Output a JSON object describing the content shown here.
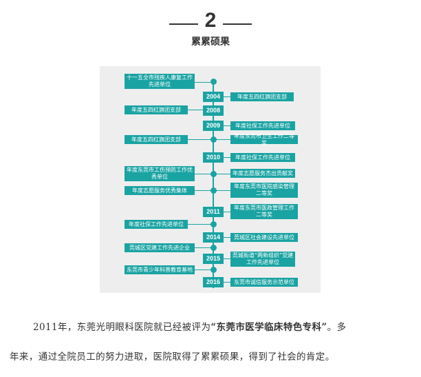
{
  "section": {
    "number": "2",
    "title": "累累硕果"
  },
  "timeline": {
    "years": [
      "2004",
      "2008",
      "2009",
      "2010",
      "2011",
      "2014",
      "2015",
      "2016"
    ],
    "left": [
      "十一五全市残疾人康复工作先进单位",
      "年度五四红旗团支部",
      "年度五四红旗团支部",
      "年度东莞市工伤预防工作优秀单位",
      "年度志愿服务优秀集体",
      "年度社保工作先进单位",
      "莞城区党建工作先进企业",
      "东莞市青少年科普教育基地"
    ],
    "right": [
      "年度五四红旗团支部",
      "年度社保工作先进单位",
      "年度东莞市卫生工作二等奖",
      "年度社保工作先进单位",
      "年度志愿服务杰出贡献奖",
      "年度东莞市医院感染管理二等奖",
      "年度东莞市医政管理工作二等奖",
      "莞城区社会建设先进单位",
      "莞城街道“两新组织”党建工作先进单位",
      "东莞市诚信服务示范单位"
    ]
  },
  "paragraph": {
    "p1_before": "2011年，东莞光明眼科医院就已经被评为",
    "p1_highlight": "“东莞市医学临床特色专科”",
    "p1_after": "。多",
    "p2": "年来，通过全院员工的努力进取，医院取得了累累硕果，得到了社会的肯定。"
  },
  "colors": {
    "accent": "#1aa3a3",
    "panel_bg": "#eeeeee",
    "text": "#333333"
  }
}
